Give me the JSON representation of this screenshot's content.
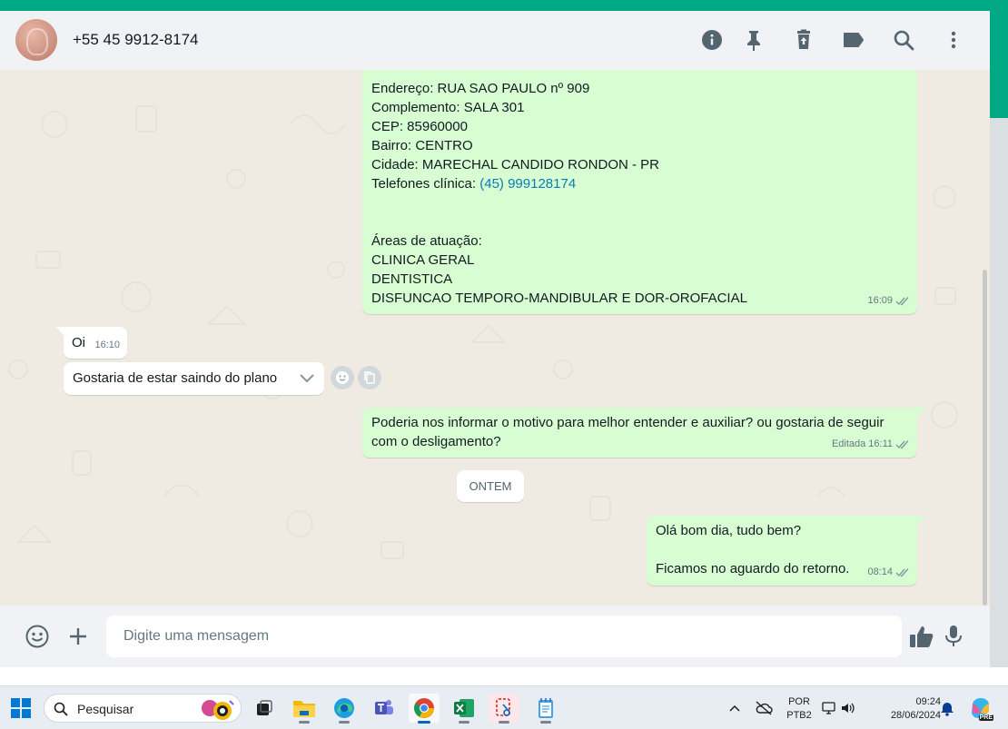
{
  "header": {
    "contact": "+55 45 9912-8174",
    "icons": [
      "info-icon",
      "pin-icon",
      "delete-icon",
      "label-icon",
      "search-icon",
      "menu-icon"
    ]
  },
  "messages": {
    "m1": {
      "lines": [
        "Endereço: RUA SAO PAULO nº 909",
        "Complemento: SALA 301",
        "CEP: 85960000",
        "Bairro: CENTRO",
        "Cidade: MARECHAL CANDIDO RONDON - PR"
      ],
      "phone_label": "Telefones clínica: ",
      "phone_link": "(45) 999128174",
      "areas_title": "Áreas de atuação:",
      "areas": [
        "CLINICA GERAL",
        "DENTISTICA",
        "DISFUNCAO TEMPORO-MANDIBULAR E DOR-OROFACIAL"
      ],
      "time": "16:09"
    },
    "m2": {
      "text": "Oi",
      "time": "16:10"
    },
    "m3": {
      "text": "Gostaria de estar saindo do plano"
    },
    "m4": {
      "line1": "Poderia nos informar o motivo para melhor entender e auxiliar? ou gostaria de seguir",
      "line2": "com o desligamento?",
      "edited": "Editada",
      "time": "16:11"
    },
    "date_divider": "ONTEM",
    "m5": {
      "line1": "Olá bom dia, tudo bem?",
      "line2": "Ficamos no aguardo do retorno.",
      "time": "08:14"
    }
  },
  "composer": {
    "placeholder": "Digite uma mensagem"
  },
  "taskbar": {
    "search_label": "Pesquisar",
    "lang_top": "POR",
    "lang_bottom": "PTB2",
    "time": "09:24",
    "date": "28/06/2024",
    "copilot_badge": "PRE"
  },
  "colors": {
    "accent": "#00a884",
    "outgoing_bubble": "#d9fdd3",
    "incoming_bubble": "#ffffff",
    "link": "#027eb5",
    "read_ticks": "#53bdeb"
  }
}
